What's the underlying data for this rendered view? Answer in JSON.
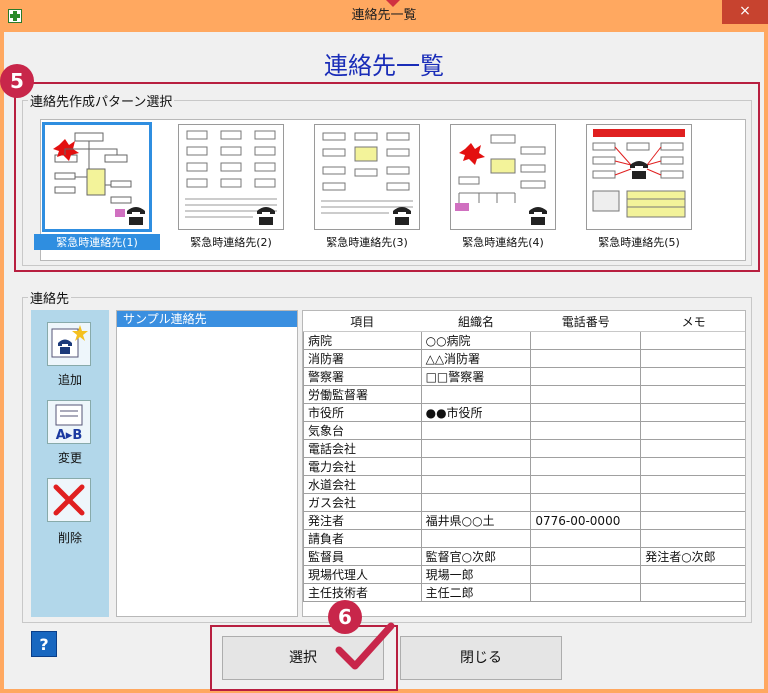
{
  "window": {
    "title": "連絡先一覧",
    "close_glyph": "×"
  },
  "heading": "連絡先一覧",
  "callouts": {
    "step5": "5",
    "step6": "6"
  },
  "pattern_group": {
    "label": "連絡先作成パターン選択",
    "patterns": [
      {
        "label": "緊急時連絡先(1)",
        "selected": true
      },
      {
        "label": "緊急時連絡先(2)",
        "selected": false
      },
      {
        "label": "緊急時連絡先(3)",
        "selected": false
      },
      {
        "label": "緊急時連絡先(4)",
        "selected": false
      },
      {
        "label": "緊急時連絡先(5)",
        "selected": false
      }
    ]
  },
  "contacts_group": {
    "label": "連絡先",
    "tools": {
      "add": "追加",
      "edit": "変更",
      "edit_icon_text": "A▸B",
      "delete": "削除"
    },
    "list": {
      "selected_item": "サンプル連絡先"
    },
    "table": {
      "headers": [
        "項目",
        "組織名",
        "電話番号",
        "メモ"
      ],
      "rows": [
        [
          "病院",
          "○○病院",
          "",
          ""
        ],
        [
          "消防署",
          "△△消防署",
          "",
          ""
        ],
        [
          "警察署",
          "□□警察署",
          "",
          ""
        ],
        [
          "労働監督署",
          "",
          "",
          ""
        ],
        [
          "市役所",
          "●●市役所",
          "",
          ""
        ],
        [
          "気象台",
          "",
          "",
          ""
        ],
        [
          "電話会社",
          "",
          "",
          ""
        ],
        [
          "電力会社",
          "",
          "",
          ""
        ],
        [
          "水道会社",
          "",
          "",
          ""
        ],
        [
          "ガス会社",
          "",
          "",
          ""
        ],
        [
          "発注者",
          "福井県○○土",
          "0776-00-0000",
          ""
        ],
        [
          "請負者",
          "",
          "",
          ""
        ],
        [
          "監督員",
          "監督官○次郎",
          "",
          "発注者○次郎"
        ],
        [
          "現場代理人",
          "現場一郎",
          "",
          ""
        ],
        [
          "主任技術者",
          "主任二郎",
          "",
          ""
        ]
      ]
    }
  },
  "footer": {
    "help": "?",
    "select": "選択",
    "close": "閉じる"
  },
  "colors": {
    "title_bar": "#ffa860",
    "heading": "#1a2db8",
    "selection": "#2f8ee0",
    "callout": "#c8264a"
  }
}
